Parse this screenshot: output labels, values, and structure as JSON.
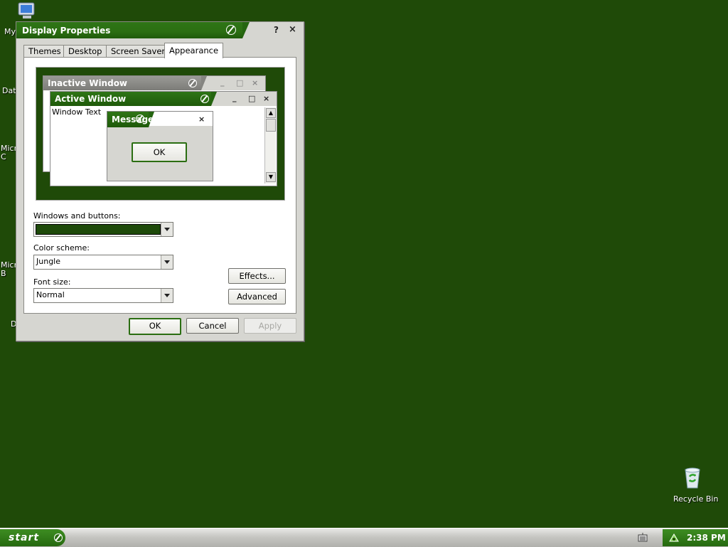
{
  "desktop": {
    "icons_left": [
      "My",
      "Dat",
      "Micr\nC",
      "Micr\nB",
      "D"
    ],
    "recycle_bin_label": "Recycle Bin"
  },
  "window": {
    "title": "Display Properties",
    "help_label": "?",
    "close_label": "×",
    "tabs": [
      "Themes",
      "Desktop",
      "Screen Saver",
      "Appearance"
    ],
    "active_tab": "Appearance",
    "preview": {
      "inactive_title": "Inactive Window",
      "active_title": "Active Window",
      "window_text": "Window Text",
      "message_title": "Message B...",
      "message_ok": "OK",
      "min_label": "_",
      "max_label": "□",
      "close_label": "×"
    },
    "windows_buttons_label": "Windows and buttons:",
    "windows_buttons_value": "",
    "color_scheme_label": "Color scheme:",
    "color_scheme_value": "Jungle",
    "font_size_label": "Font size:",
    "font_size_value": "Normal",
    "effects_label": "Effects...",
    "advanced_label": "Advanced",
    "ok_label": "OK",
    "cancel_label": "Cancel",
    "apply_label": "Apply"
  },
  "taskbar": {
    "start_label": "start",
    "clock": "2:38 PM"
  },
  "colors": {
    "desktop": "#1f4a08",
    "title_green": "#2b6e12",
    "scheme_swatch": "#1e4a0a"
  }
}
